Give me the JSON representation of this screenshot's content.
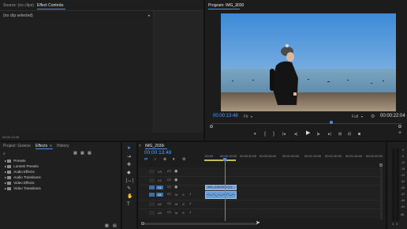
{
  "source_panel": {
    "tabs": [
      "Source: (no clips)",
      "Effect Controls",
      "≡"
    ],
    "no_clip": "(no clip selected)",
    "timecode": "00:00:13:48"
  },
  "program_panel": {
    "title": "Program: IMG_2030",
    "menu": "≡",
    "timecode": "00:00:13:48",
    "fit": "Fit",
    "full": "Full",
    "duration": "00:00:22:04"
  },
  "project_panel": {
    "tabs": [
      "Project: Greece",
      "Effects",
      "≡",
      "History"
    ],
    "search_icon": "search-icon",
    "items": [
      "Presets",
      "Lumetri Presets",
      "Audio Effects",
      "Audio Transitions",
      "Video Effects",
      "Video Transitions"
    ]
  },
  "timeline": {
    "sequence": "IMG_2030",
    "menu": "≡",
    "timecode": "00:00:13:48",
    "ruler_labels": [
      ":00:00",
      "00:00:15:00",
      "00:00:30:00",
      "00:00:45:00",
      "00:01:00:00",
      "00:01:15:00",
      "00:01:30:00",
      "00:01:45:00",
      "00:02:00:00"
    ],
    "video_tracks": [
      "V3",
      "V2",
      "V1"
    ],
    "audio_tracks": [
      "A1",
      "A2",
      "A3"
    ],
    "clip_label": "IMG_2030.MOV [V]",
    "meter_labels": [
      "0",
      "-6",
      "-12",
      "-18",
      "-24",
      "-30",
      "-36",
      "-42",
      "-48",
      "-54",
      "dB"
    ],
    "meter_footer": [
      "S",
      "S"
    ]
  }
}
